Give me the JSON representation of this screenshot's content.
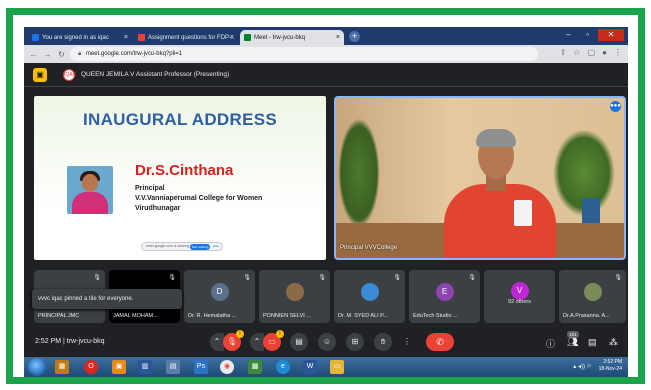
{
  "browser": {
    "tabs": [
      {
        "label": "You are signed in as iqac",
        "favicon_color": "#1a73e8"
      },
      {
        "label": "Assignment questions for FDP-..",
        "favicon_color": "#ea4335"
      },
      {
        "label": "Meet - trw-jvcu-bkq",
        "favicon_color": "#00832d",
        "active": true
      }
    ],
    "new_tab": "+",
    "url": "meet.google.com/trw-jvcu-bkq?pli=1"
  },
  "presenting": {
    "avatar_initials": "IQAC",
    "text": "QUEEN JEMILA V Assistant Professor (Presenting)"
  },
  "slide": {
    "title": "INAUGURAL ADDRESS",
    "name": "Dr.S.Cinthana",
    "line1": "Principal",
    "line2": "V.V.Vanniaperumal College for Women",
    "line3": "Virudhunagar",
    "share_bar_text": "meet.google.com is sharing your screen.",
    "share_bar_stop": "Stop sharing",
    "share_bar_hide": "Hide"
  },
  "video": {
    "label": "Principal VVVCollege",
    "speaking": "●●●"
  },
  "toast": {
    "text": "vvvc iqac pinned a tile for everyone."
  },
  "participants": [
    {
      "name": "PRINCIPAL JMC",
      "avatar": "",
      "color": "#3c4043"
    },
    {
      "name": "JAMAL MOHAM...",
      "avatar": "",
      "color": "#000000"
    },
    {
      "name": "Dr. R. Hemalatha ...",
      "avatar": "D",
      "color": "#5b6f89"
    },
    {
      "name": "PONNIEN SELVI ...",
      "avatar": "",
      "color": "#8a6b45"
    },
    {
      "name": "Dr. M. SYED ALI P...",
      "avatar": "",
      "color": "#3d8ad6"
    },
    {
      "name": "EduTech Studio ...",
      "avatar": "E",
      "color": "#8e44ad"
    },
    {
      "name": "92 others",
      "avatar": "V",
      "color": "#c026d3"
    },
    {
      "name": "Dr.A.Prasanna. A...",
      "avatar": "",
      "color": "#7a8c5a"
    }
  ],
  "controls": {
    "meeting": "2:52 PM  |  trw-jvcu-bkq",
    "mic_badge": "!",
    "cam_badge": "!",
    "people_count": "101"
  },
  "taskbar": {
    "time": "2:52 PM",
    "date": "18-Nov-24"
  }
}
